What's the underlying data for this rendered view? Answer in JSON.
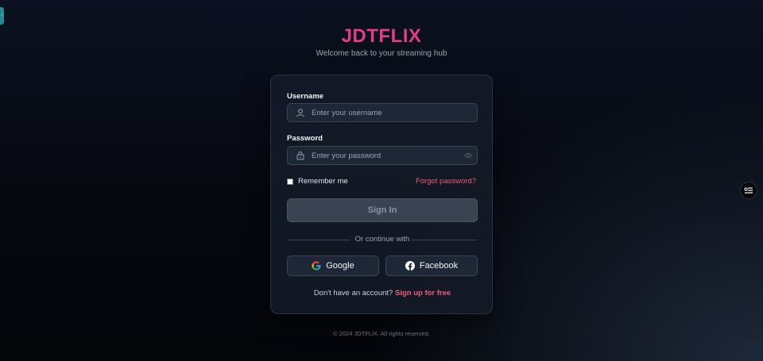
{
  "brand": {
    "title": "JDTFLIX",
    "tagline": "Welcome back to your streaming hub"
  },
  "form": {
    "username_label": "Username",
    "username_placeholder": "Enter your username",
    "password_label": "Password",
    "password_placeholder": "Enter your password",
    "remember_label": "Remember me",
    "forgot_label": "Forgot password?",
    "signin_label": "Sign In",
    "divider_text": "Or continue with",
    "google_label": "Google",
    "facebook_label": "Facebook",
    "signup_prompt": "Don't have an account?",
    "signup_link": "Sign up for free"
  },
  "footer": {
    "text": "© 2024 JDTFLIX. All rights reserved."
  },
  "icons": {
    "user": "user-icon",
    "lock": "lock-icon",
    "eye": "eye-icon",
    "google": "google-icon",
    "facebook": "facebook-icon",
    "settings": "filter-icon"
  },
  "colors": {
    "brand": "#e23e86",
    "link": "#ef5c78",
    "card_bg": "#141b28",
    "button_disabled": "#3a4352"
  }
}
